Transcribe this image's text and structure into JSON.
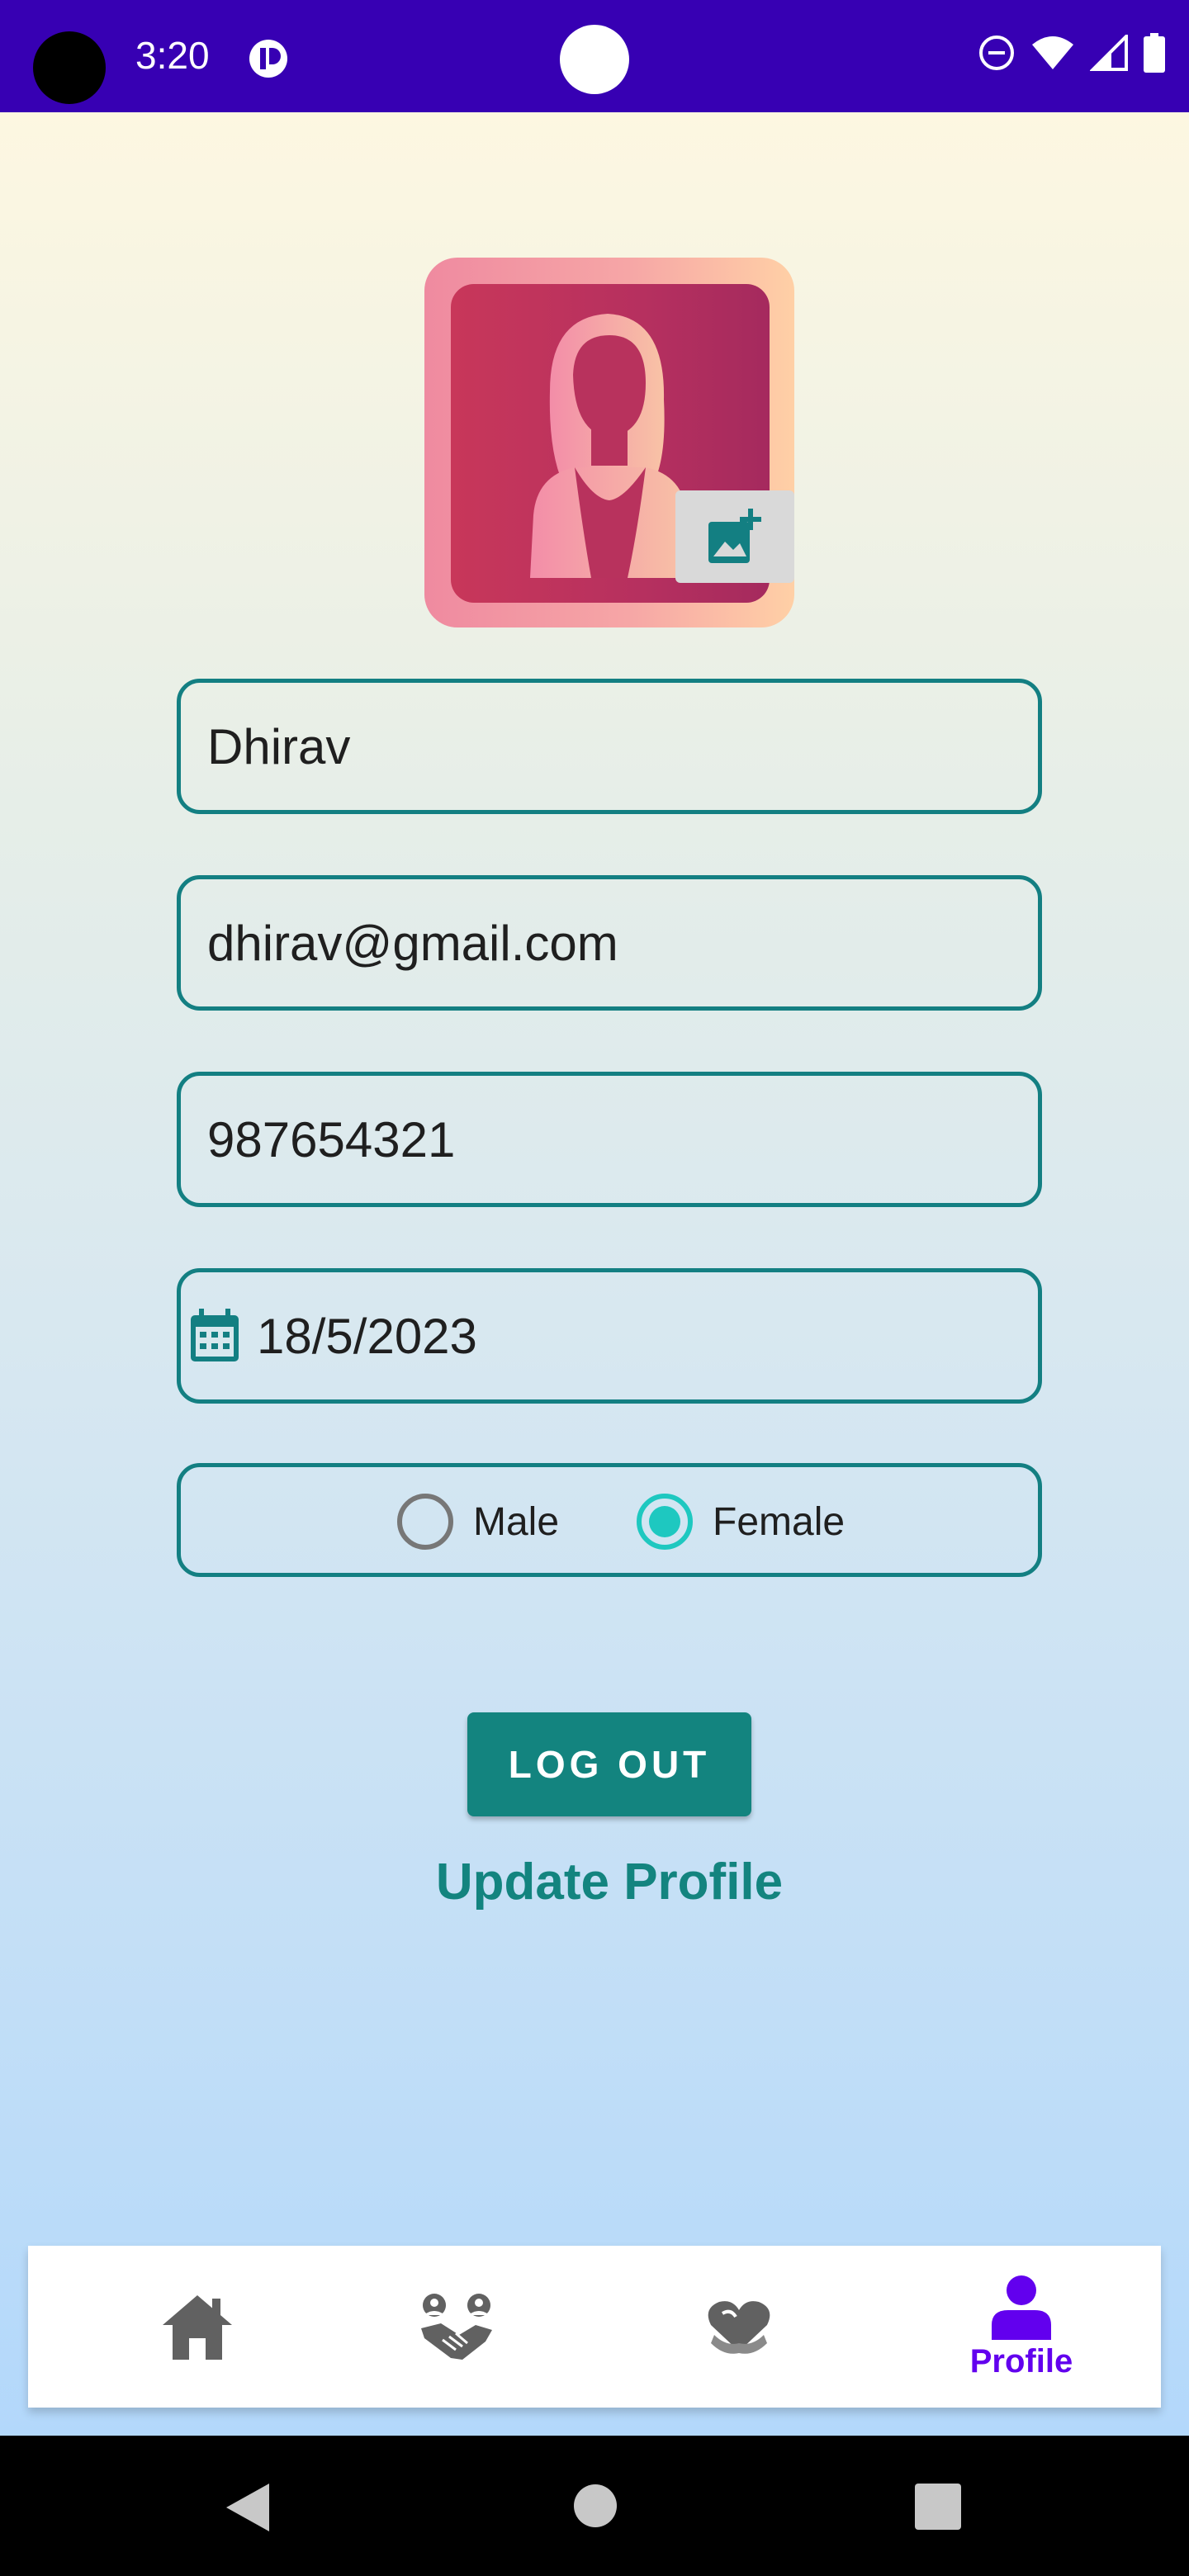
{
  "status_bar": {
    "time": "3:20",
    "icons": [
      "app-notification-icon",
      "do-not-disturb-icon",
      "wifi-icon",
      "signal-icon",
      "battery-icon"
    ],
    "background": "#3700b3"
  },
  "profile": {
    "avatar_icon": "woman-avatar-icon",
    "add_photo_icon": "add-photo-icon",
    "name_value": "Dhirav",
    "email_value": "dhirav@gmail.com",
    "phone_value": "987654321",
    "dob_value": "18/5/2023",
    "gender": {
      "options": [
        "Male",
        "Female"
      ],
      "selected": "Female"
    }
  },
  "actions": {
    "logout_label": "LOG OUT",
    "update_label": "Update Profile"
  },
  "bottom_nav": {
    "items": [
      {
        "icon": "home-icon",
        "label": ""
      },
      {
        "icon": "handshake-icon",
        "label": ""
      },
      {
        "icon": "heart-hands-icon",
        "label": ""
      },
      {
        "icon": "person-icon",
        "label": "Profile"
      }
    ],
    "active_index": 3
  },
  "colors": {
    "accent": "#13847f",
    "field_border": "#137f82",
    "radio_checked": "#1ec8c0",
    "nav_active": "#6200ee",
    "nav_inactive": "#616161"
  }
}
